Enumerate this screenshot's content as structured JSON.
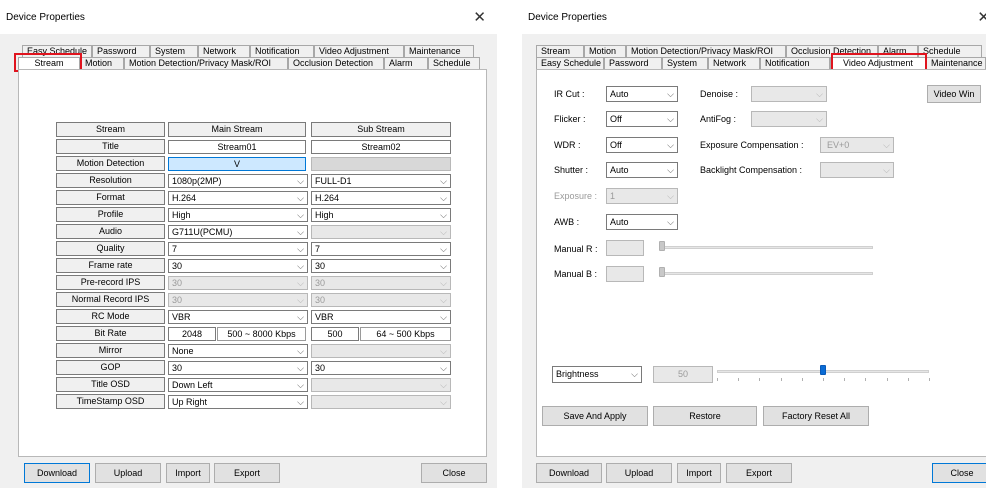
{
  "left": {
    "title": "Device Properties",
    "close_glyph": "✕",
    "tabs_row1": [
      "Easy Schedule",
      "Password",
      "System",
      "Network",
      "Notification",
      "Video Adjustment",
      "Maintenance"
    ],
    "tabs_row2": [
      "Stream",
      "Motion",
      "Motion Detection/Privacy Mask/ROI",
      "Occlusion Detection",
      "Alarm",
      "Schedule"
    ],
    "selected_tab": "Stream",
    "table": {
      "col_headers": [
        "Stream",
        "Main Stream",
        "Sub Stream"
      ],
      "title_row": {
        "label": "Title",
        "main": "Stream01",
        "sub": "Stream02"
      },
      "motion_row": {
        "label": "Motion Detection",
        "main": "V",
        "sub": ""
      },
      "resolution": {
        "label": "Resolution",
        "main": "1080p(2MP)",
        "sub": "FULL-D1"
      },
      "format": {
        "label": "Format",
        "main": "H.264",
        "sub": "H.264"
      },
      "profile": {
        "label": "Profile",
        "main": "High",
        "sub": "High"
      },
      "audio": {
        "label": "Audio",
        "main": "G711U(PCMU)",
        "sub": ""
      },
      "quality": {
        "label": "Quality",
        "main": "7",
        "sub": "7"
      },
      "frame_rate": {
        "label": "Frame rate",
        "main": "30",
        "sub": "30"
      },
      "pre_record": {
        "label": "Pre-record IPS",
        "main": "30",
        "sub": "30"
      },
      "normal_record": {
        "label": "Normal Record IPS",
        "main": "30",
        "sub": "30"
      },
      "rc_mode": {
        "label": "RC Mode",
        "main": "VBR",
        "sub": "VBR"
      },
      "bit_rate": {
        "label": "Bit Rate",
        "main": "2048",
        "main_range": "500 ~ 8000 Kbps",
        "sub": "500",
        "sub_range": "64 ~ 500 Kbps"
      },
      "mirror": {
        "label": "Mirror",
        "main": "None",
        "sub": ""
      },
      "gop": {
        "label": "GOP",
        "main": "30",
        "sub": "30"
      },
      "title_osd": {
        "label": "Title OSD",
        "main": "Down Left",
        "sub": ""
      },
      "timestamp_osd": {
        "label": "TimeStamp OSD",
        "main": "Up Right",
        "sub": ""
      }
    },
    "buttons": {
      "download": "Download",
      "upload": "Upload",
      "import": "Import",
      "export": "Export",
      "close": "Close"
    }
  },
  "right": {
    "title": "Device Properties",
    "close_glyph": "✕",
    "tabs_row1": [
      "Stream",
      "Motion",
      "Motion Detection/Privacy Mask/ROI",
      "Occlusion Detection",
      "Alarm",
      "Schedule"
    ],
    "tabs_row2": [
      "Easy Schedule",
      "Password",
      "System",
      "Network",
      "Notification",
      "Video Adjustment",
      "Maintenance"
    ],
    "selected_tab": "Video Adjustment",
    "fields": {
      "ir_cut": {
        "label": "IR Cut :",
        "value": "Auto"
      },
      "flicker": {
        "label": "Flicker :",
        "value": "Off"
      },
      "wdr": {
        "label": "WDR :",
        "value": "Off"
      },
      "shutter": {
        "label": "Shutter :",
        "value": "Auto"
      },
      "exposure": {
        "label": "Exposure :",
        "value": "1"
      },
      "awb": {
        "label": "AWB :",
        "value": "Auto"
      },
      "manual_r": {
        "label": "Manual R :",
        "value": ""
      },
      "manual_b": {
        "label": "Manual B :",
        "value": ""
      },
      "denoise": {
        "label": "Denoise :",
        "value": ""
      },
      "antifog": {
        "label": "AntiFog :",
        "value": ""
      },
      "exposure_comp": {
        "label": "Exposure Compensation :",
        "value": "EV+0"
      },
      "backlight_comp": {
        "label": "Backlight Compensation :",
        "value": ""
      },
      "brightness": {
        "label": "Brightness",
        "value": "50"
      }
    },
    "video_win_button": "Video Win",
    "action_buttons": {
      "save": "Save And Apply",
      "restore": "Restore",
      "factory": "Factory Reset All"
    },
    "buttons": {
      "download": "Download",
      "upload": "Upload",
      "import": "Import",
      "export": "Export",
      "close": "Close"
    },
    "brightness_level": 0.5
  },
  "icons": {
    "dropdown": "chevron-down-icon",
    "close": "close-icon"
  },
  "colors": {
    "highlight": "#e0141e",
    "selected_cell": "#cde8ff",
    "slider_thumb": "#0a6cd6"
  }
}
